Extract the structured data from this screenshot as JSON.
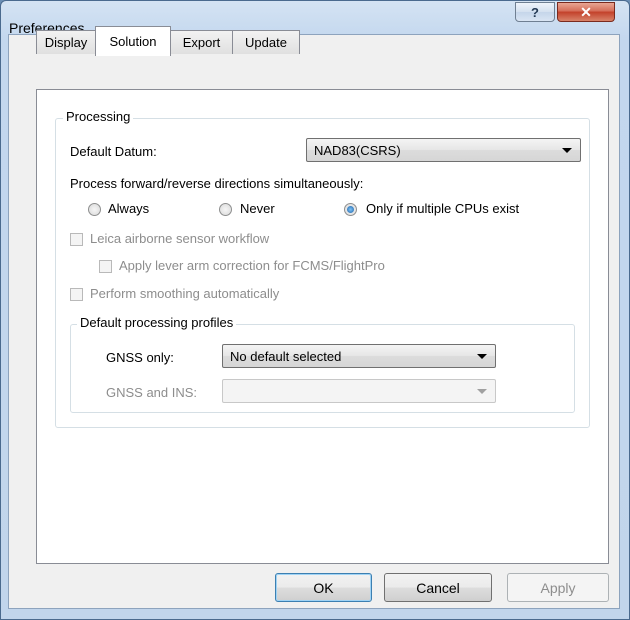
{
  "window": {
    "title": "Preferences"
  },
  "titlebar": {
    "help_glyph": "?",
    "close_glyph": "✕"
  },
  "tabs": [
    {
      "label": "Display",
      "active": false
    },
    {
      "label": "Solution",
      "active": true
    },
    {
      "label": "Export",
      "active": false
    },
    {
      "label": "Update",
      "active": false
    }
  ],
  "processing": {
    "legend": "Processing",
    "default_datum_label": "Default Datum:",
    "default_datum_value": "NAD83(CSRS)",
    "direction_label": "Process forward/reverse directions simultaneously:",
    "radio_always": "Always",
    "radio_never": "Never",
    "radio_multi_cpu": "Only if multiple CPUs exist",
    "selected_radio": "Only if multiple CPUs exist",
    "leica_label": "Leica airborne sensor workflow",
    "lever_arm_label": "Apply lever arm correction for FCMS/FlightPro",
    "smoothing_label": "Perform smoothing automatically"
  },
  "profiles": {
    "legend": "Default processing profiles",
    "gnss_only_label": "GNSS only:",
    "gnss_only_value": "No default selected",
    "gnss_ins_label": "GNSS and INS:",
    "gnss_ins_value": ""
  },
  "buttons": {
    "ok": "OK",
    "cancel": "Cancel",
    "apply": "Apply"
  }
}
